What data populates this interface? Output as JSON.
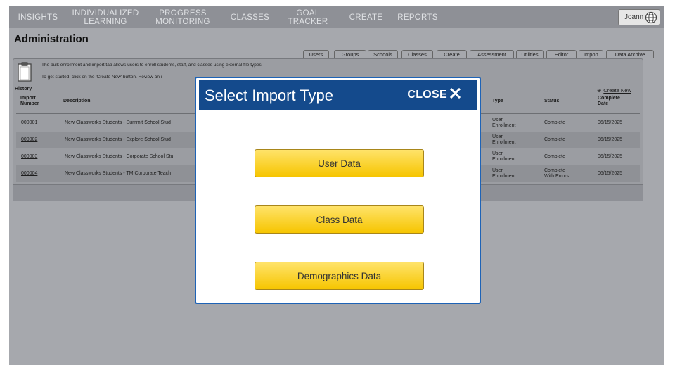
{
  "nav": {
    "items": [
      {
        "label": "INSIGHTS"
      },
      {
        "label": "INDIVIDUALIZED\nLEARNING"
      },
      {
        "label": "PROGRESS\nMONITORING"
      },
      {
        "label": "CLASSES"
      },
      {
        "label": "GOAL TRACKER"
      },
      {
        "label": "CREATE"
      },
      {
        "label": "REPORTS"
      }
    ],
    "user_name": "Joann"
  },
  "page_title": "Administration",
  "tabs": [
    "Users",
    "Groups",
    "Schools",
    "Classes",
    "Create",
    "Assessment",
    "Utilities",
    "Editor",
    "Import",
    "Data Archive"
  ],
  "panel": {
    "info_line_1": "The bulk enrollment and import tab allows users to enroll students, staff, and classes using external file types.",
    "info_line_2": "To get started, click on the 'Create New' button. Review an i",
    "history_label": "History",
    "create_new_label": "Create New",
    "create_new_icon": "plus-circle-icon"
  },
  "table": {
    "headers": {
      "import_number": "Import\nNumber",
      "description": "Description",
      "type": "Type",
      "status": "Status",
      "complete_date": "Complete\nDate"
    },
    "rows": [
      {
        "number": "000001",
        "description": "New Classworks Students - Summit School Stud",
        "type": "User\nEnrollment",
        "status": "Complete",
        "date": "06/15/2025"
      },
      {
        "number": "000002",
        "description": "New Classworks Students - Explore School Stud",
        "type": "User\nEnrollment",
        "status": "Complete",
        "date": "06/15/2025"
      },
      {
        "number": "000003",
        "description": "New Classworks Students - Corporate School Stu",
        "type": "User\nEnrollment",
        "status": "Complete",
        "date": "06/15/2025"
      },
      {
        "number": "000004",
        "description": "New Classworks Students - TM Corporate Teach",
        "type": "User\nEnrollment",
        "status": "Complete\nWith Errors",
        "date": "06/15/2025"
      }
    ]
  },
  "modal": {
    "title": "Select Import Type",
    "close_label": "CLOSE",
    "close_icon": "close-icon",
    "buttons": [
      "User Data",
      "Class Data",
      "Demographics Data"
    ]
  },
  "colors": {
    "nav_bg": "#8e9096",
    "page_bg": "#a6a8ad",
    "modal_header": "#144a8c",
    "modal_border": "#1e63b6",
    "button_yellow": "#f6c500"
  }
}
